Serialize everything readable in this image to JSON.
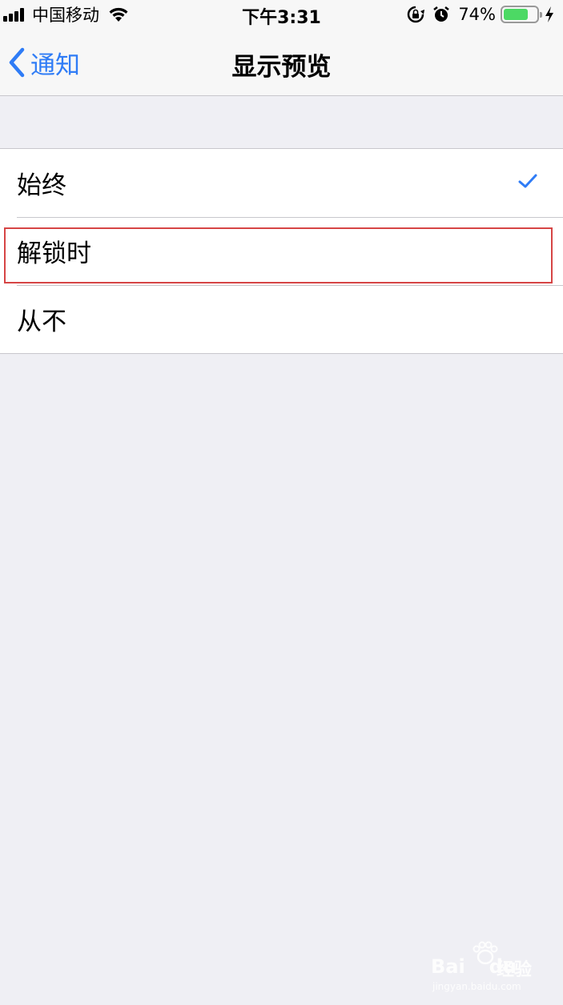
{
  "status_bar": {
    "carrier": "中国移动",
    "time": "下午3:31",
    "battery_percent": "74%",
    "battery_level": 0.74,
    "icons": [
      "signal-icon",
      "wifi-icon",
      "rotation-lock-icon",
      "alarm-icon",
      "battery-icon",
      "charging-icon"
    ]
  },
  "nav": {
    "back_label": "通知",
    "title": "显示预览"
  },
  "options": [
    {
      "label": "始终",
      "selected": true
    },
    {
      "label": "解锁时",
      "selected": false,
      "highlighted": true
    },
    {
      "label": "从不",
      "selected": false
    }
  ],
  "watermark": {
    "brand": "Bai",
    "brand_suffix": "du",
    "product": "经验",
    "url": "jingyan.baidu.com"
  },
  "colors": {
    "accent": "#2f7cf6",
    "highlight": "#d64545",
    "background": "#efeff4",
    "battery": "#4cd964"
  }
}
